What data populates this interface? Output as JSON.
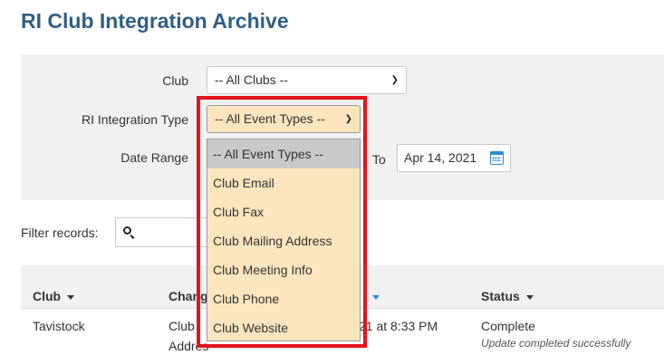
{
  "page": {
    "title": "RI Club Integration Archive"
  },
  "filters": {
    "club_label": "Club",
    "club_value": "-- All Clubs --",
    "type_label": "RI Integration Type",
    "type_value": "-- All Event Types --",
    "date_label": "Date Range",
    "date_to_label": "To",
    "date_to_value": "Apr 14, 2021"
  },
  "dropdown": {
    "options": [
      "-- All Event Types --",
      "Club Email",
      "Club Fax",
      "Club Mailing Address",
      "Club Meeting Info",
      "Club Phone",
      "Club Website"
    ],
    "selected_index": 0
  },
  "records_filter": {
    "label": "Filter records:"
  },
  "table": {
    "columns": [
      "Club",
      "Chang",
      "Status"
    ],
    "sorted_column": "date",
    "rows": [
      {
        "club": "Tavistock",
        "change_line1": "Club",
        "change_line2": "Addres",
        "date": "21 at 8:33 PM",
        "status": "Complete",
        "status_detail": "Update completed successfully"
      }
    ]
  },
  "colors": {
    "title": "#2f5f86",
    "panel": "#f1f1f1",
    "select_highlight": "#fde6bd",
    "callout": "#e2151b",
    "accent": "#2a8ed0"
  },
  "icons": {
    "search": "search-icon",
    "calendar": "calendar-icon",
    "select": "chevron-down-icon",
    "sort": "sort-caret-icon"
  }
}
